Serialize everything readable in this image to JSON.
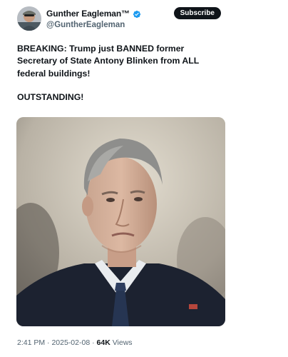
{
  "author": {
    "display_name": "Gunther Eagleman™",
    "handle": "@GuntherEagleman",
    "verified": true,
    "badge_color": "#1d9bf0"
  },
  "subscribe_label": "Subscribe",
  "tweet": {
    "paragraphs": [
      "BREAKING: Trump just BANNED former Secretary of State Antony Blinken from ALL federal buildings!",
      "OUTSTANDING!"
    ]
  },
  "media": {
    "type": "photo"
  },
  "meta": {
    "time": "2:41 PM",
    "date": "2025-02-08",
    "views_count": "64K",
    "views_label": "Views",
    "separator": "·"
  }
}
